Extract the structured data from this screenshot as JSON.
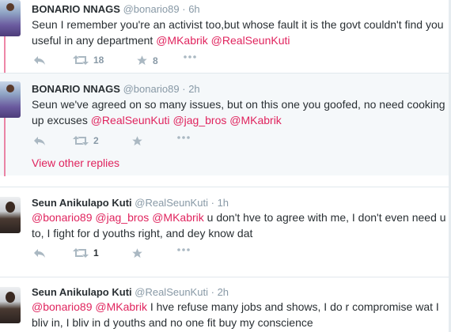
{
  "colors": {
    "mention": "#e0245e",
    "meta": "#8899a6",
    "text": "#292f33",
    "icon": "#aab8c2",
    "highlight_bg": "#f5f8fa"
  },
  "tweets": [
    {
      "name": "BONARIO NNAGS",
      "handle": "@bonario89",
      "dot": "·",
      "time": "6h",
      "text_segments": [
        {
          "t": "Seun I remember you're an activist too,but whose fault it is the govt couldn't find you useful in any department "
        },
        {
          "m": "@MKabrik"
        },
        {
          "t": " "
        },
        {
          "m": "@RealSeunKuti"
        }
      ],
      "retweets": "18",
      "likes": "8"
    },
    {
      "name": "BONARIO NNAGS",
      "handle": "@bonario89",
      "dot": "·",
      "time": "2h",
      "text_segments": [
        {
          "t": "Seun we've agreed on so many issues, but on this one you goofed, no need cooking up excuses "
        },
        {
          "m": "@RealSeunKuti"
        },
        {
          "t": " "
        },
        {
          "m": "@jag_bros"
        },
        {
          "t": " "
        },
        {
          "m": "@MKabrik"
        }
      ],
      "retweets": "2",
      "likes": "",
      "view_replies": "View other replies"
    },
    {
      "name": "Seun Anikulapo Kuti",
      "handle": "@RealSeunKuti",
      "dot": "·",
      "time": "1h",
      "text_segments": [
        {
          "m": "@bonario89"
        },
        {
          "t": " "
        },
        {
          "m": "@jag_bros"
        },
        {
          "t": " "
        },
        {
          "m": "@MKabrik"
        },
        {
          "t": " u don't hve to agree with me, I don't even need u to, I fight for d youths right, and dey know dat"
        }
      ],
      "retweets": "1",
      "likes": ""
    },
    {
      "name": "Seun Anikulapo Kuti",
      "handle": "@RealSeunKuti",
      "dot": "·",
      "time": "2h",
      "text_segments": [
        {
          "m": "@bonario89"
        },
        {
          "t": " "
        },
        {
          "m": "@MKabrik"
        },
        {
          "t": " I hve refuse many jobs and shows, I do r compromise wat I bliv in, I bliv in d youths and no one fit buy my conscience"
        }
      ]
    }
  ],
  "icons": {
    "reply": "reply-icon",
    "retweet": "retweet-icon",
    "like": "star-icon",
    "more": "more-icon"
  }
}
